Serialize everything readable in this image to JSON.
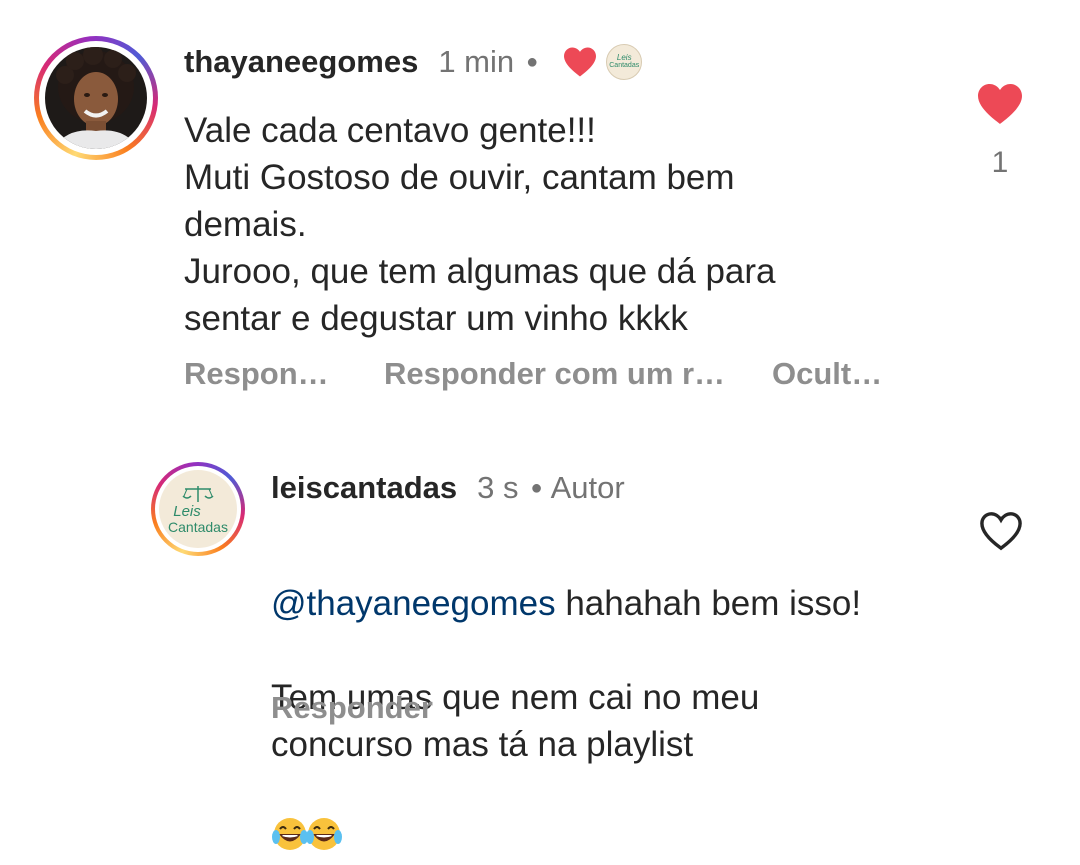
{
  "comment": {
    "username": "thayaneegomes",
    "time": "1 min",
    "text_lines": "Vale cada centavo gente!!!\nMuti Gostoso de ouvir, cantam bem\ndemais.\nJurooo, que tem algumas que dá para\nsentar e degustar um vinho kkkk",
    "like_count": "1",
    "actions": {
      "reply": "Respon…",
      "reply_with": "Responder com um r…",
      "hide": "Ocult…"
    },
    "liked": true
  },
  "reply": {
    "username": "leiscantadas",
    "time": "3 s",
    "author_badge": "Autor",
    "mention": "@thayaneegomes",
    "text_first": " hahahah bem isso!",
    "text_rest": "Tem umas que nem cai no meu\nconcurso mas tá na playlist",
    "action_reply": "Responder",
    "liked": false
  },
  "logo": {
    "line1": "Leis",
    "line2": "Cantadas",
    "mini_line1": "Leis",
    "mini_line2": "Cantadas"
  },
  "colors": {
    "heart_red": "#ed4956",
    "mention_blue": "#00376b",
    "logo_green": "#2e8b6a",
    "logo_bg": "#f3ead9"
  }
}
